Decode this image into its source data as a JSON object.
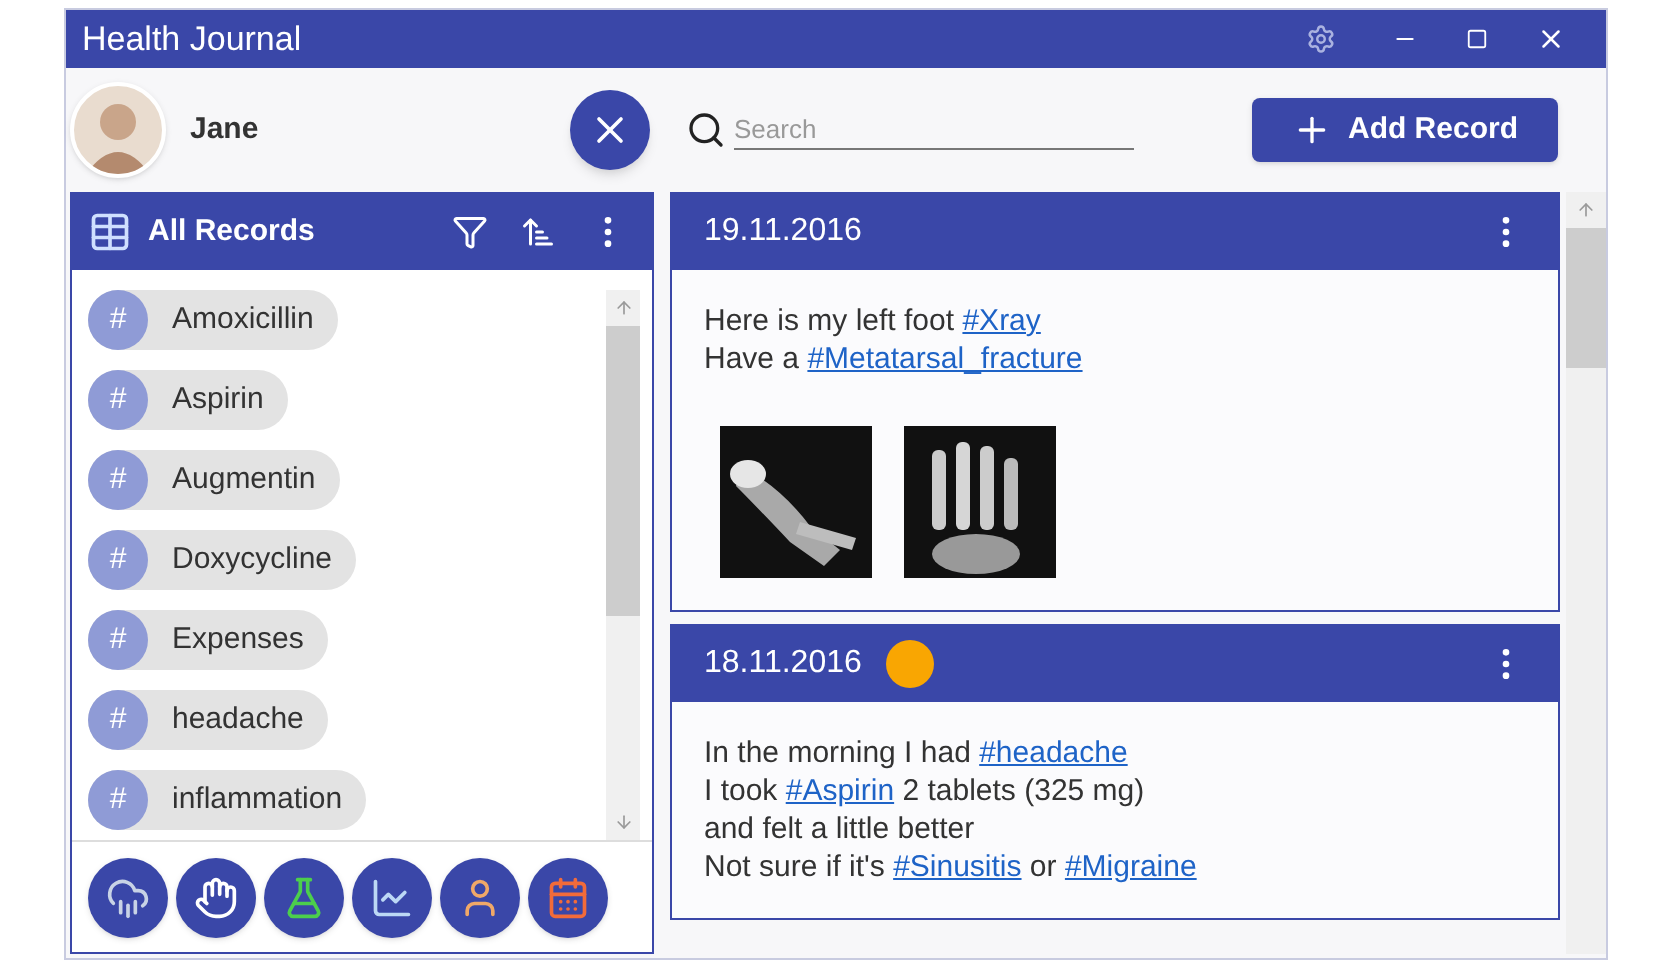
{
  "window": {
    "title": "Health Journal"
  },
  "user": {
    "name": "Jane"
  },
  "search": {
    "placeholder": "Search"
  },
  "add_button": {
    "label": "Add Record"
  },
  "records_panel": {
    "title": "All Records",
    "tags": [
      {
        "icon": "#",
        "label": "Amoxicillin"
      },
      {
        "icon": "#",
        "label": "Aspirin"
      },
      {
        "icon": "#",
        "label": "Augmentin"
      },
      {
        "icon": "#",
        "label": "Doxycycline"
      },
      {
        "icon": "#",
        "label": "Expenses"
      },
      {
        "icon": "#",
        "label": "headache"
      },
      {
        "icon": "#",
        "label": "inflammation"
      }
    ]
  },
  "records": [
    {
      "date": "19.11.2016",
      "lines": [
        [
          {
            "text": "Here is my left foot "
          },
          {
            "text": "#Xray",
            "link": true
          }
        ],
        [
          {
            "text": "Have a "
          },
          {
            "text": "#Metatarsal_fracture",
            "link": true
          }
        ]
      ],
      "pictures": [
        {
          "kind": "picture"
        },
        {
          "kind": "picture"
        }
      ]
    },
    {
      "date": "18.11.2016",
      "color": "#f9a602",
      "lines": [
        [
          {
            "text": "In the morning I had "
          },
          {
            "text": "#headache",
            "link": true
          }
        ],
        [
          {
            "text": "I took "
          },
          {
            "text": "#Aspirin",
            "link": true
          },
          {
            "text": " 2 tablets (325 mg)"
          }
        ],
        [
          {
            "text": "and felt a little better"
          }
        ],
        [
          {
            "text": "Not sure if it's "
          },
          {
            "text": "#Sinusitis",
            "link": true
          },
          {
            "text": " or "
          },
          {
            "text": "#Migraine",
            "link": true
          }
        ]
      ]
    }
  ]
}
